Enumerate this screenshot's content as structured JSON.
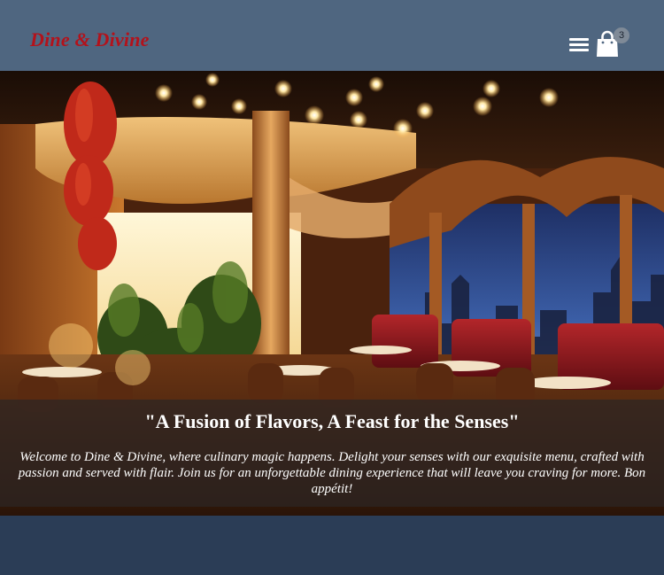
{
  "header": {
    "brand": "Dine & Divine",
    "menu_icon": "hamburger-menu-icon",
    "cart_icon": "shopping-bag-icon",
    "cart_count": "3"
  },
  "hero": {
    "image": "restaurant-interior-photo",
    "title": "\"A Fusion of Flavors, A Feast for the Senses\"",
    "description": "Welcome to Dine & Divine, where culinary magic happens. Delight your senses with our exquisite menu, crafted with passion and served with flair. Join us for an unforgettable dining experience that will leave you craving for more. Bon appétit!"
  },
  "colors": {
    "header_bg": "#4f6680",
    "brand": "#b3121b",
    "page_bg": "#2b3d56"
  }
}
